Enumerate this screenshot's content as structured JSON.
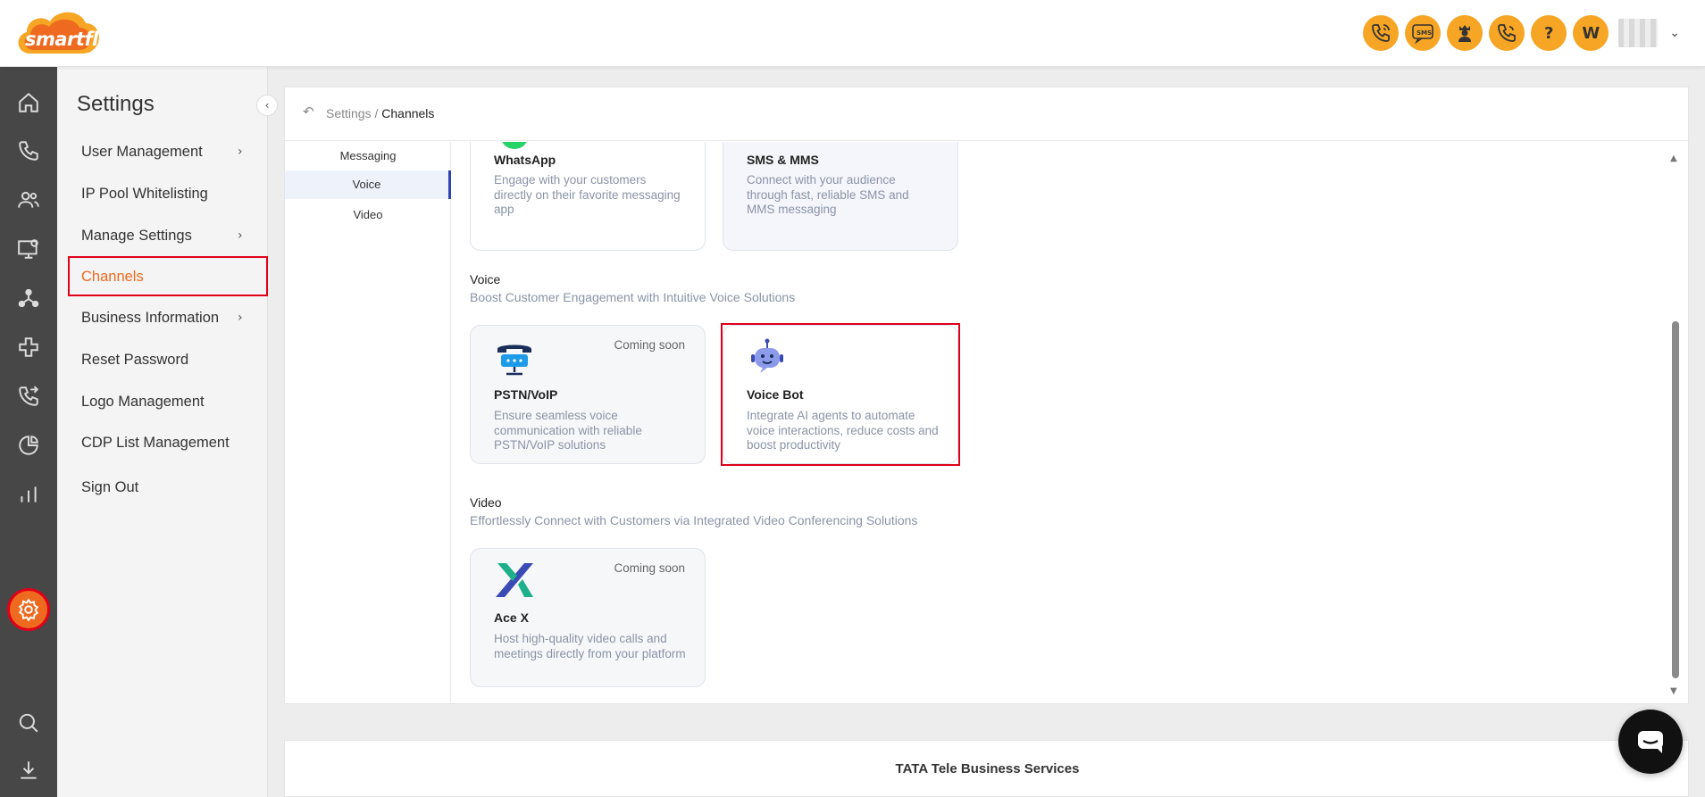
{
  "app": {
    "logo_text": "smartflo"
  },
  "topbar": {
    "icons": [
      "phone-call-icon",
      "sms-icon",
      "agent-icon",
      "phone-ring-icon",
      "help-icon"
    ],
    "sms_label": "SMS",
    "help_label": "?",
    "avatar_initial": "W"
  },
  "rail": {
    "items": [
      "home-icon",
      "phone-icon",
      "users-icon",
      "monitor-settings-icon",
      "network-icon",
      "integration-icon",
      "call-transfer-icon",
      "pie-chart-icon",
      "bar-chart-icon",
      "settings-icon",
      "search-icon",
      "download-icon"
    ],
    "active": "settings-icon"
  },
  "sidebar": {
    "title": "Settings",
    "items": [
      {
        "label": "User Management",
        "has_children": true
      },
      {
        "label": "IP Pool Whitelisting",
        "has_children": false
      },
      {
        "label": "Manage Settings",
        "has_children": true
      },
      {
        "label": "Channels",
        "has_children": false,
        "active": true
      },
      {
        "label": "Business Information",
        "has_children": true
      },
      {
        "label": "Reset Password",
        "has_children": false
      },
      {
        "label": "Logo Management",
        "has_children": false
      },
      {
        "label": "CDP List Management",
        "has_children": false
      },
      {
        "label": "Sign Out",
        "has_children": false
      }
    ]
  },
  "breadcrumb": {
    "parent": "Settings",
    "separator": "/",
    "current": "Channels"
  },
  "subnav": {
    "items": [
      {
        "label": "Messaging",
        "active": false
      },
      {
        "label": "Voice",
        "active": true
      },
      {
        "label": "Video",
        "active": false
      }
    ]
  },
  "messaging": {
    "cards": [
      {
        "title": "WhatsApp",
        "desc": "Engage with your customers directly on their favorite messaging app",
        "icon": "whatsapp-icon"
      },
      {
        "title": "SMS & MMS",
        "desc": "Connect with your audience through fast, reliable SMS and MMS messaging",
        "icon": "sms-mms-icon"
      }
    ]
  },
  "voice": {
    "title": "Voice",
    "subtitle": "Boost Customer Engagement with Intuitive Voice Solutions",
    "cards": [
      {
        "title": "PSTN/VoIP",
        "desc": "Ensure seamless voice communication with reliable PSTN/VoIP solutions",
        "badge": "Coming soon",
        "icon": "telephone-icon"
      },
      {
        "title": "Voice Bot",
        "desc": "Integrate AI agents to automate voice interactions, reduce costs and boost productivity",
        "badge": "",
        "icon": "robot-icon"
      }
    ]
  },
  "video": {
    "title": "Video",
    "subtitle": "Effortlessly Connect with Customers via Integrated Video Conferencing Solutions",
    "cards": [
      {
        "title": "Ace X",
        "desc": "Host high-quality video calls and meetings directly from your platform",
        "badge": "Coming soon",
        "icon": "ace-x-icon"
      }
    ]
  },
  "footer": {
    "text": "TATA Tele Business Services"
  },
  "colors": {
    "accent": "#ee6a1f",
    "highlight": "#e0001a",
    "brand_yellow": "#f7a524",
    "rail": "#474747"
  }
}
